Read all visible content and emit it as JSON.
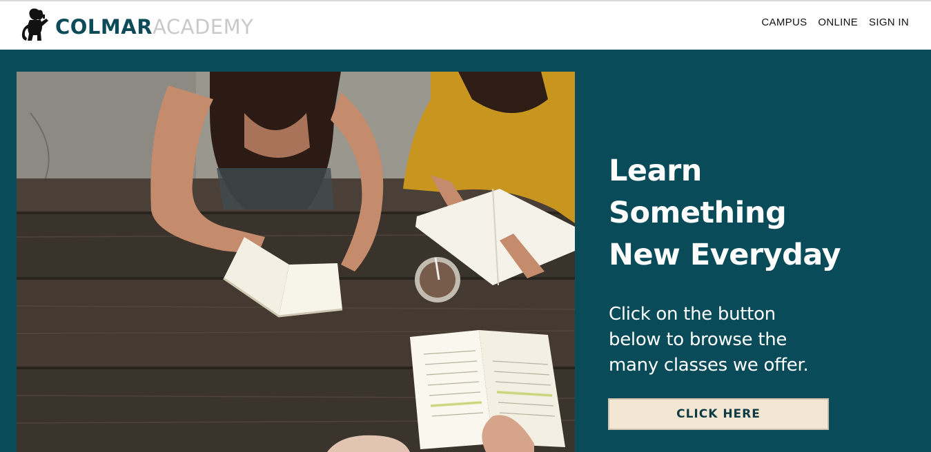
{
  "header": {
    "brand_primary": "COLMAR",
    "brand_secondary": "ACADEMY",
    "nav": [
      {
        "label": "CAMPUS"
      },
      {
        "label": "ONLINE"
      },
      {
        "label": "SIGN IN"
      }
    ]
  },
  "hero": {
    "headline": "Learn\nSomething\nNew Everyday",
    "subtext": "Click on the button\nbelow to browse the\nmany classes we offer.",
    "cta_label": "CLICK HERE"
  },
  "colors": {
    "hero_bg": "#0a4b5a",
    "brand_dark": "#0d4b58",
    "brand_light": "#c9c9c9",
    "cta_bg": "#f3e6d3"
  },
  "icons": {
    "logo": "lion-rampant-icon"
  }
}
